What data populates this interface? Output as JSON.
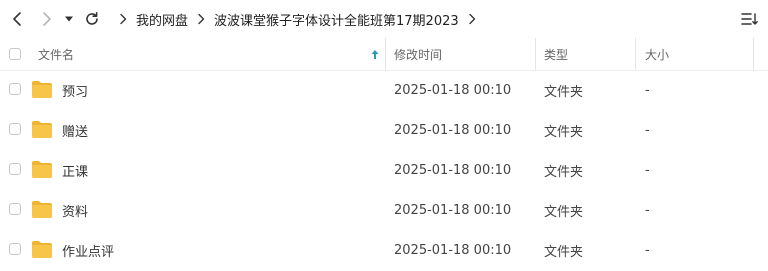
{
  "toolbar": {
    "back_icon": "chevron-left-icon",
    "forward_icon": "chevron-right-icon",
    "dropdown_icon": "caret-down-icon",
    "refresh_icon": "refresh-icon",
    "view_icon": "list-view-icon"
  },
  "breadcrumb": [
    "我的网盘",
    "波波课堂猴子字体设计全能班第17期2023"
  ],
  "columns": {
    "name": "文件名",
    "modified": "修改时间",
    "type": "类型",
    "size": "大小",
    "sort_icon": "sort-arrow-up-icon"
  },
  "files": [
    {
      "name": "预习",
      "modified": "2025-01-18 00:10",
      "type": "文件夹",
      "size": "-"
    },
    {
      "name": "赠送",
      "modified": "2025-01-18 00:10",
      "type": "文件夹",
      "size": "-"
    },
    {
      "name": "正课",
      "modified": "2025-01-18 00:10",
      "type": "文件夹",
      "size": "-"
    },
    {
      "name": "资料",
      "modified": "2025-01-18 00:10",
      "type": "文件夹",
      "size": "-"
    },
    {
      "name": "作业点评",
      "modified": "2025-01-18 00:10",
      "type": "文件夹",
      "size": "-"
    }
  ],
  "colors": {
    "folder": "#f7c54a",
    "folder_tab": "#f0b432",
    "sort_arrow": "#2a9bb5"
  }
}
